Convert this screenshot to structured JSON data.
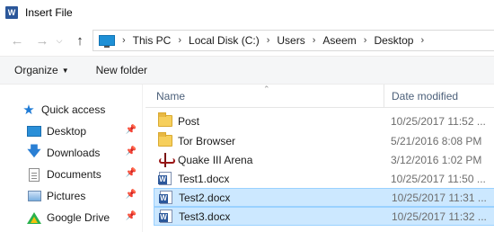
{
  "window": {
    "title": "Insert File",
    "app_icon_letter": "W"
  },
  "nav": {
    "back_icon": "back-arrow-icon",
    "forward_icon": "forward-arrow-icon",
    "recent_icon": "chevron-down-icon",
    "up_icon": "up-arrow-icon",
    "breadcrumb": [
      "This PC",
      "Local Disk (C:)",
      "Users",
      "Aseem",
      "Desktop"
    ]
  },
  "toolbar": {
    "organize_label": "Organize",
    "new_folder_label": "New folder"
  },
  "sidebar": {
    "quick_access_label": "Quick access",
    "items": [
      {
        "label": "Desktop",
        "icon": "desktop-icon",
        "pinned": true
      },
      {
        "label": "Downloads",
        "icon": "downloads-icon",
        "pinned": true
      },
      {
        "label": "Documents",
        "icon": "documents-icon",
        "pinned": true
      },
      {
        "label": "Pictures",
        "icon": "pictures-icon",
        "pinned": true
      },
      {
        "label": "Google Drive",
        "icon": "google-drive-icon",
        "pinned": true
      }
    ]
  },
  "filelist": {
    "columns": {
      "name": "Name",
      "date_modified": "Date modified"
    },
    "files": [
      {
        "name": "Post",
        "date": "10/25/2017 11:52 ...",
        "type": "folder",
        "selected": false
      },
      {
        "name": "Tor Browser",
        "date": "5/21/2016 8:08 PM",
        "type": "folder",
        "selected": false
      },
      {
        "name": "Quake III Arena",
        "date": "3/12/2016 1:02 PM",
        "type": "shortcut",
        "selected": false
      },
      {
        "name": "Test1.docx",
        "date": "10/25/2017 11:50 ...",
        "type": "word",
        "selected": false
      },
      {
        "name": "Test2.docx",
        "date": "10/25/2017 11:31 ...",
        "type": "word",
        "selected": true
      },
      {
        "name": "Test3.docx",
        "date": "10/25/2017 11:32 ...",
        "type": "word",
        "selected": true
      }
    ]
  },
  "colors": {
    "selection_bg": "#cce8ff",
    "selection_border": "#99d1ff",
    "header_text": "#4c607a",
    "date_text": "#6d6d6d"
  }
}
